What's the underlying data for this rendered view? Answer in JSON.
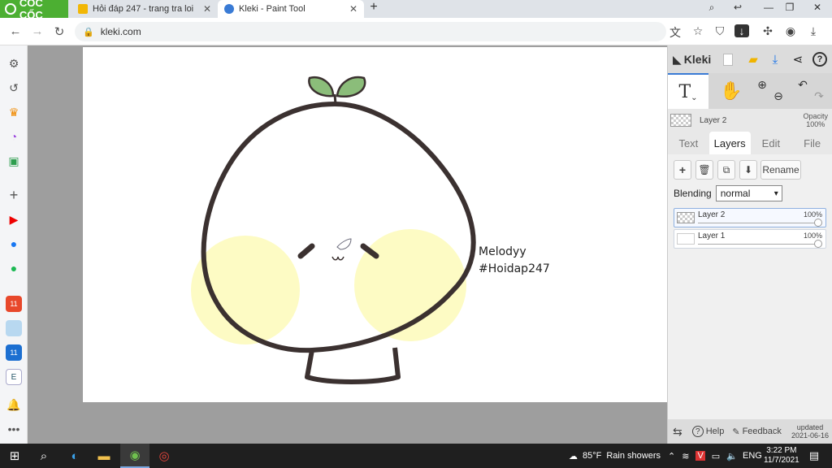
{
  "browser": {
    "brand": "CỐC CỐC",
    "tabs": [
      {
        "title": "Hỏi đáp 247 - trang tra loi",
        "fav_color": "#f2b705"
      },
      {
        "title": "Kleki - Paint Tool",
        "fav_color": "#3a7bd5"
      }
    ],
    "url": "kleki.com",
    "new_tab": "+"
  },
  "artwork": {
    "signature_line1": "Melodyy",
    "signature_line2": "#Hoidap247",
    "colors": {
      "outline": "#3b3130",
      "cheek": "#fdfbc4",
      "leaf": "#8bbd7a"
    }
  },
  "kleki": {
    "logo": "Kleki",
    "tool_text": "T",
    "current_layer": "Layer 2",
    "opacity_label": "Opacity",
    "opacity_value": "100%",
    "tabs": [
      "Text",
      "Layers",
      "Edit",
      "File"
    ],
    "active_tab": "Layers",
    "rename_label": "Rename",
    "blending_label": "Blending",
    "blending_value": "normal",
    "layers": [
      {
        "name": "Layer 2",
        "opacity": "100%",
        "opacity_value": 1.0
      },
      {
        "name": "Layer 1",
        "opacity": "100%",
        "opacity_value": 1.0
      }
    ],
    "footer": {
      "help": "Help",
      "feedback": "Feedback",
      "updated_label": "updated",
      "updated_date": "2021-06-16"
    }
  },
  "taskbar": {
    "weather_temp": "85°F",
    "weather_desc": "Rain showers",
    "lang": "ENG",
    "time": "3:22 PM",
    "date": "11/7/2021"
  }
}
